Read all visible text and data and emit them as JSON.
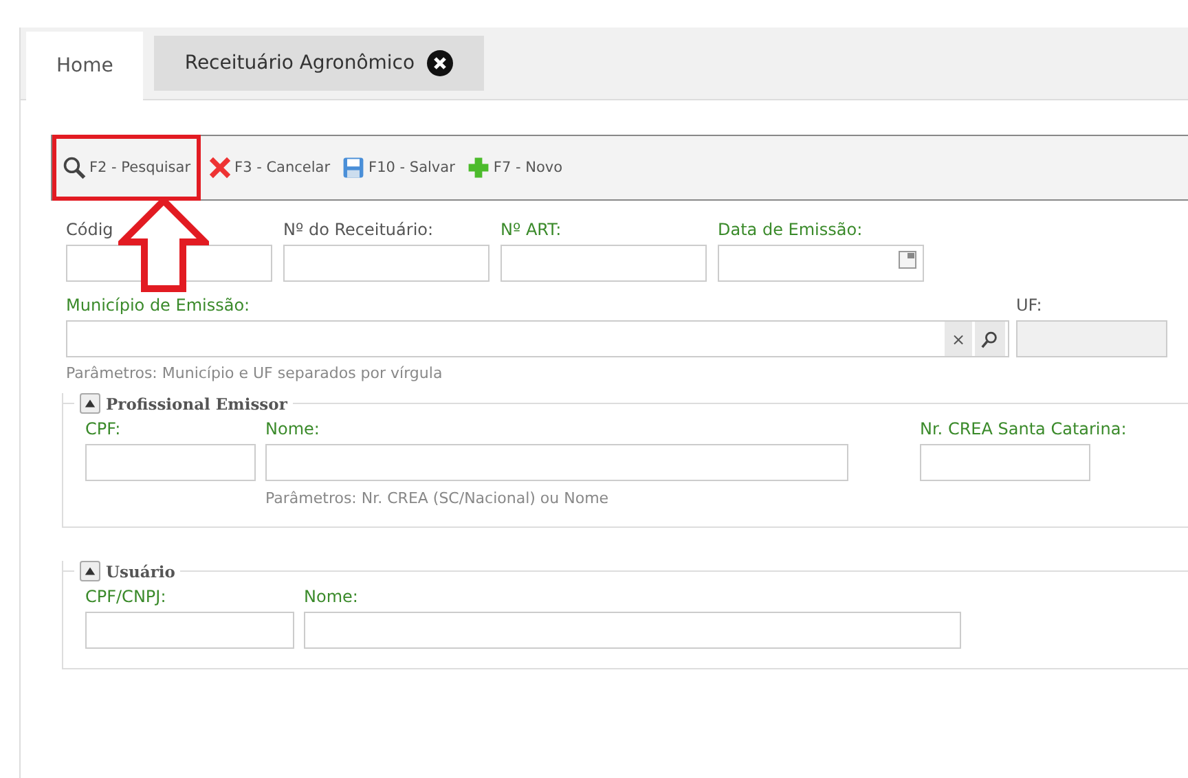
{
  "tabs": [
    {
      "label": "Home",
      "selected": true,
      "closable": false
    },
    {
      "label": "Receituário Agronômico",
      "selected": false,
      "closable": true
    }
  ],
  "toolbar": [
    {
      "label": "F2 - Pesquisar",
      "kind": "search",
      "highlighted": true
    },
    {
      "label": "F3 - Cancelar",
      "kind": "cancel",
      "highlighted": false
    },
    {
      "label": "F10 - Salvar",
      "kind": "save",
      "highlighted": false
    },
    {
      "label": "F7 - Novo",
      "kind": "new",
      "highlighted": false
    }
  ],
  "row_1": [
    {
      "label": "Códig",
      "required": false,
      "kind": "text"
    },
    {
      "label": "Nº do Receituário:",
      "required": false,
      "kind": "text"
    },
    {
      "label": "Nº ART:",
      "required": true,
      "kind": "text"
    },
    {
      "label": "Data de Emissão:",
      "required": true,
      "kind": "date"
    }
  ],
  "municipio": {
    "label": "Município de Emissão:",
    "required": true,
    "hint": "Parâmetros: Município e UF separados por vírgula",
    "clear": "×"
  },
  "uf": {
    "label": "UF:",
    "required": false
  },
  "sections": [
    {
      "legend": "Profissional Emissor",
      "expanded": true,
      "fields": [
        {
          "label": "CPF:",
          "required": true
        },
        {
          "label": "Nome:",
          "required": true,
          "hint": "Parâmetros: Nr. CREA (SC/Nacional) ou Nome"
        },
        {
          "label": "Nr. CREA Santa Catarina:",
          "required": true
        }
      ]
    },
    {
      "legend": "Usuário",
      "expanded": true,
      "fields": [
        {
          "label": "CPF/CNPJ:",
          "required": true
        },
        {
          "label": "Nome:",
          "required": true
        }
      ]
    }
  ]
}
